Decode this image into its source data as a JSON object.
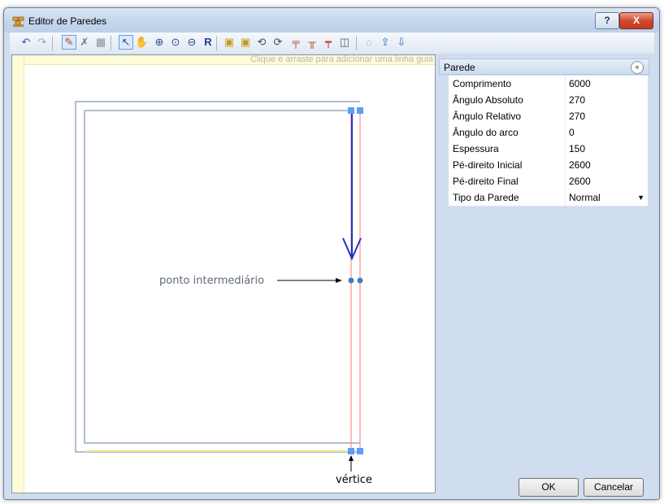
{
  "window": {
    "title": "Editor de Paredes",
    "help_label": "?",
    "close_label": "X"
  },
  "toolbar": {
    "tools": [
      {
        "name": "undo-icon",
        "glyph": "↶",
        "color": "#2b5fb0"
      },
      {
        "name": "redo-icon",
        "glyph": "↷",
        "color": "#9aa6b6"
      },
      {
        "name": "draw-wall-icon",
        "glyph": "✎",
        "color": "#c0392b"
      },
      {
        "name": "erase-wall-icon",
        "glyph": "✗",
        "color": "#6b7c93"
      },
      {
        "name": "grid-icon",
        "glyph": "▦",
        "color": "#8a9099"
      },
      {
        "name": "select-pointer-icon",
        "glyph": "↖",
        "color": "#1f4f8f"
      },
      {
        "name": "pan-hand-icon",
        "glyph": "✋",
        "color": "#a0722c"
      },
      {
        "name": "zoom-in-icon",
        "glyph": "⊕",
        "color": "#2b4f7f"
      },
      {
        "name": "zoom-window-icon",
        "glyph": "⊙",
        "color": "#2b4f7f"
      },
      {
        "name": "zoom-out-icon",
        "glyph": "⊖",
        "color": "#2b4f7f"
      },
      {
        "name": "reset-view-icon",
        "glyph": "R",
        "color": "#1d3d8f"
      },
      {
        "name": "add-wall-icon",
        "glyph": "▣",
        "color": "#c79a1d"
      },
      {
        "name": "remove-wall-icon",
        "glyph": "▣",
        "color": "#c79a1d"
      },
      {
        "name": "rotate-add-icon",
        "glyph": "⟲",
        "color": "#3b4f6b"
      },
      {
        "name": "rotate-remove-icon",
        "glyph": "⟳",
        "color": "#3b4f6b"
      },
      {
        "name": "split-wall-icon",
        "glyph": "╤",
        "color": "#c0392b"
      },
      {
        "name": "join-walls-icon",
        "glyph": "╥",
        "color": "#c0392b"
      },
      {
        "name": "align-walls-icon",
        "glyph": "┯",
        "color": "#c0392b"
      },
      {
        "name": "offset-wall-icon",
        "glyph": "◫",
        "color": "#4a5d78"
      },
      {
        "name": "roof-icon",
        "glyph": "⌂",
        "color": "#b0b8c4"
      },
      {
        "name": "import-icon",
        "glyph": "⇪",
        "color": "#2b6fb8"
      },
      {
        "name": "export-icon",
        "glyph": "⇩",
        "color": "#2b6fb8"
      }
    ]
  },
  "canvas": {
    "guide_hint": "Clique e arraste para adicionar uma linha guia",
    "annotation_midpoint": "ponto intermediário",
    "annotation_vertex": "vértice"
  },
  "panel": {
    "title": "Parede",
    "collapse_glyph": "«",
    "properties": [
      {
        "name": "Comprimento",
        "value": "6000"
      },
      {
        "name": "Ângulo Absoluto",
        "value": "270"
      },
      {
        "name": "Ângulo Relativo",
        "value": "270"
      },
      {
        "name": "Ângulo do arco",
        "value": "0"
      },
      {
        "name": "Espessura",
        "value": "150"
      },
      {
        "name": "Pé-direito Inicial",
        "value": "2600"
      },
      {
        "name": "Pé-direito Final",
        "value": "2600"
      },
      {
        "name": "Tipo da Parede",
        "value": "Normal",
        "dropdown": true
      }
    ]
  },
  "buttons": {
    "ok": "OK",
    "cancel": "Cancelar"
  },
  "colors": {
    "wall_outline": "#5f7fa3",
    "selected_wall": "#ff7a7a",
    "direction_arrow": "#1f2fd0",
    "vertex_handle": "#5aa0f5",
    "floor_edge": "#f3e48a"
  }
}
